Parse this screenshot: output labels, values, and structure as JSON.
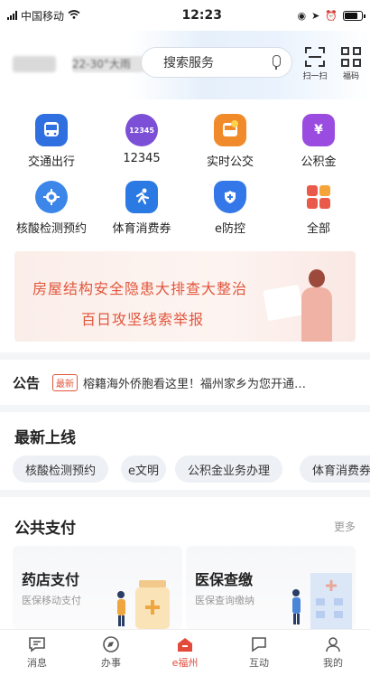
{
  "status_bar": {
    "carrier": "中国移动",
    "time": "12:23"
  },
  "header": {
    "weather": "22-30°大雨",
    "search_placeholder": "搜索服务",
    "scan_label": "扫一扫",
    "code_label": "福码"
  },
  "services": [
    {
      "label": "交通出行",
      "icon": "bus-icon",
      "color": "#2f6fe0"
    },
    {
      "label": "12345",
      "icon": "hotline-12345-icon",
      "color": "#7b4fd6"
    },
    {
      "label": "实时公交",
      "icon": "realtime-bus-icon",
      "color": "#f08a2a"
    },
    {
      "label": "公积金",
      "icon": "fund-icon",
      "color": "#9a4be0"
    },
    {
      "label": "核酸检测预约",
      "icon": "virus-test-icon",
      "color": "#3b86e8"
    },
    {
      "label": "体育消费券",
      "icon": "runner-icon",
      "color": "#2b7ae4"
    },
    {
      "label": "e防控",
      "icon": "shield-plus-icon",
      "color": "#3477e8"
    },
    {
      "label": "全部",
      "icon": "all-apps-icon",
      "color": "#ea5a4a"
    }
  ],
  "banner": {
    "line1": "房屋结构安全隐患大排查大整治",
    "line2": "百日攻坚线索举报"
  },
  "notice": {
    "tag": "公告",
    "badge": "最新",
    "text": "榕籍海外侨胞看这里！福州家乡为您开通…"
  },
  "latest": {
    "title": "最新上线",
    "chips": [
      "核酸检测预约",
      "e文明",
      "公积金业务办理",
      "体育消费券"
    ]
  },
  "payment": {
    "title": "公共支付",
    "more": "更多",
    "cards": [
      {
        "title": "药店支付",
        "subtitle": "医保移动支付"
      },
      {
        "title": "医保查缴",
        "subtitle": "医保查询缴纳"
      }
    ]
  },
  "tabs": [
    {
      "label": "消息",
      "icon": "message-icon"
    },
    {
      "label": "办事",
      "icon": "compass-icon"
    },
    {
      "label": "e福州",
      "icon": "home-icon"
    },
    {
      "label": "互动",
      "icon": "flag-icon"
    },
    {
      "label": "我的",
      "icon": "profile-icon"
    }
  ],
  "colors": {
    "accent": "#e24b3a",
    "banner_text": "#e2563c"
  }
}
